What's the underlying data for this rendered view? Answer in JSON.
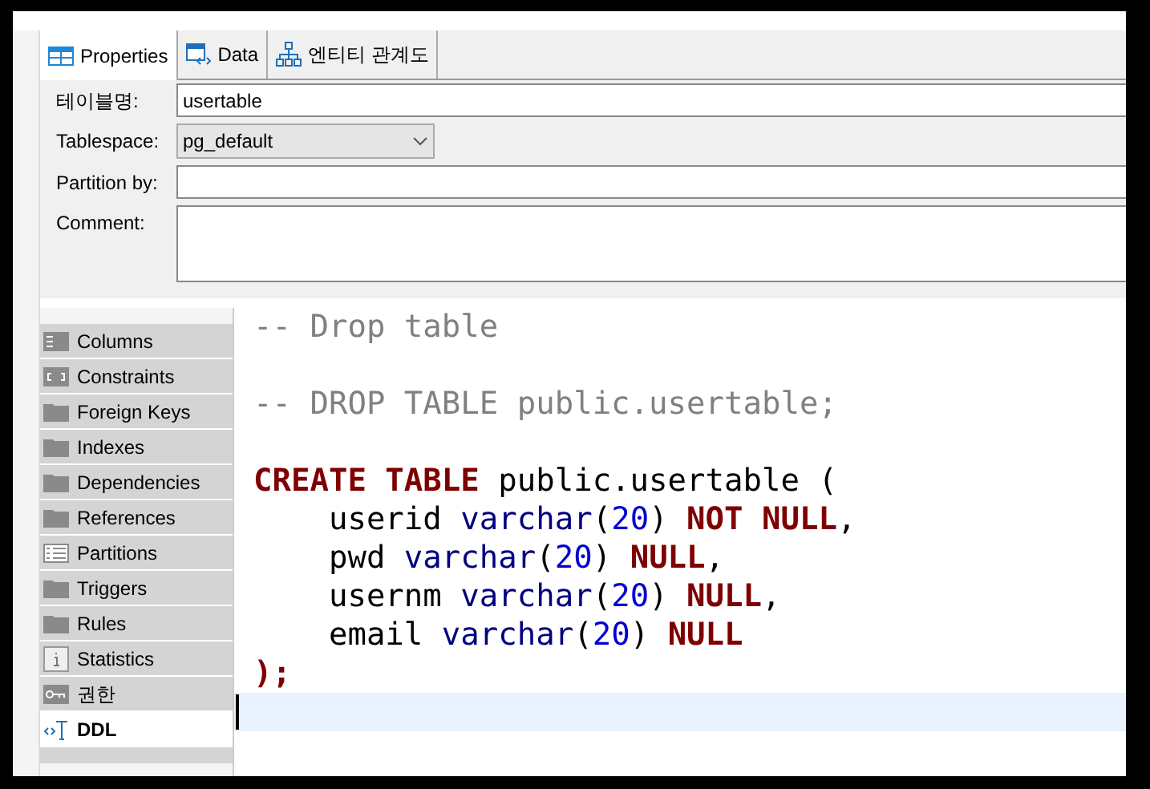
{
  "tabs": [
    {
      "label": "Properties",
      "kind": "table",
      "selected": true
    },
    {
      "label": "Data",
      "kind": "data",
      "selected": false
    },
    {
      "label": "엔티티 관계도",
      "kind": "diagram",
      "selected": false
    }
  ],
  "form": {
    "table_name": {
      "label": "테이블명:",
      "value": "usertable"
    },
    "tablespace": {
      "label": "Tablespace:",
      "value": "pg_default"
    },
    "partition_by": {
      "label": "Partition by:"
    },
    "comment": {
      "label": "Comment:"
    }
  },
  "sidebar": {
    "items": [
      {
        "label": "Columns",
        "kind": "columns",
        "selected": false
      },
      {
        "label": "Constraints",
        "kind": "constraints",
        "selected": false
      },
      {
        "label": "Foreign Keys",
        "kind": "folder",
        "selected": false
      },
      {
        "label": "Indexes",
        "kind": "folder",
        "selected": false
      },
      {
        "label": "Dependencies",
        "kind": "folder",
        "selected": false
      },
      {
        "label": "References",
        "kind": "folder",
        "selected": false
      },
      {
        "label": "Partitions",
        "kind": "list",
        "selected": false
      },
      {
        "label": "Triggers",
        "kind": "folder",
        "selected": false
      },
      {
        "label": "Rules",
        "kind": "folder",
        "selected": false
      },
      {
        "label": "Statistics",
        "kind": "info",
        "selected": false
      },
      {
        "label": "권한",
        "kind": "key",
        "selected": false
      },
      {
        "label": "DDL",
        "kind": "ddl",
        "selected": true
      }
    ]
  },
  "code": {
    "lines": [
      {
        "kind": "text",
        "tokens": [
          {
            "kind": "comment",
            "text": "-- Drop table"
          }
        ]
      },
      {
        "kind": "blank"
      },
      {
        "kind": "text",
        "tokens": [
          {
            "kind": "comment",
            "text": "-- DROP TABLE public.usertable;"
          }
        ]
      },
      {
        "kind": "blank"
      },
      {
        "kind": "text",
        "tokens": [
          {
            "kind": "keyword",
            "text": "CREATE TABLE"
          },
          {
            "kind": "plain",
            "text": " public.usertable ("
          }
        ]
      },
      {
        "kind": "text",
        "tokens": [
          {
            "kind": "plain",
            "text": "    userid "
          },
          {
            "kind": "type",
            "text": "varchar"
          },
          {
            "kind": "plain",
            "text": "("
          },
          {
            "kind": "number",
            "text": "20"
          },
          {
            "kind": "plain",
            "text": ") "
          },
          {
            "kind": "keyword",
            "text": "NOT NULL"
          },
          {
            "kind": "plain",
            "text": ","
          }
        ]
      },
      {
        "kind": "text",
        "tokens": [
          {
            "kind": "plain",
            "text": "    pwd "
          },
          {
            "kind": "type",
            "text": "varchar"
          },
          {
            "kind": "plain",
            "text": "("
          },
          {
            "kind": "number",
            "text": "20"
          },
          {
            "kind": "plain",
            "text": ") "
          },
          {
            "kind": "keyword",
            "text": "NULL"
          },
          {
            "kind": "plain",
            "text": ","
          }
        ]
      },
      {
        "kind": "text",
        "tokens": [
          {
            "kind": "plain",
            "text": "    usernm "
          },
          {
            "kind": "type",
            "text": "varchar"
          },
          {
            "kind": "plain",
            "text": "("
          },
          {
            "kind": "number",
            "text": "20"
          },
          {
            "kind": "plain",
            "text": ") "
          },
          {
            "kind": "keyword",
            "text": "NULL"
          },
          {
            "kind": "plain",
            "text": ","
          }
        ]
      },
      {
        "kind": "text",
        "tokens": [
          {
            "kind": "plain",
            "text": "    email "
          },
          {
            "kind": "type",
            "text": "varchar"
          },
          {
            "kind": "plain",
            "text": "("
          },
          {
            "kind": "number",
            "text": "20"
          },
          {
            "kind": "plain",
            "text": ") "
          },
          {
            "kind": "keyword",
            "text": "NULL"
          }
        ]
      },
      {
        "kind": "text",
        "tokens": [
          {
            "kind": "keyword",
            "text": ");"
          }
        ]
      },
      {
        "kind": "cursor"
      }
    ]
  }
}
